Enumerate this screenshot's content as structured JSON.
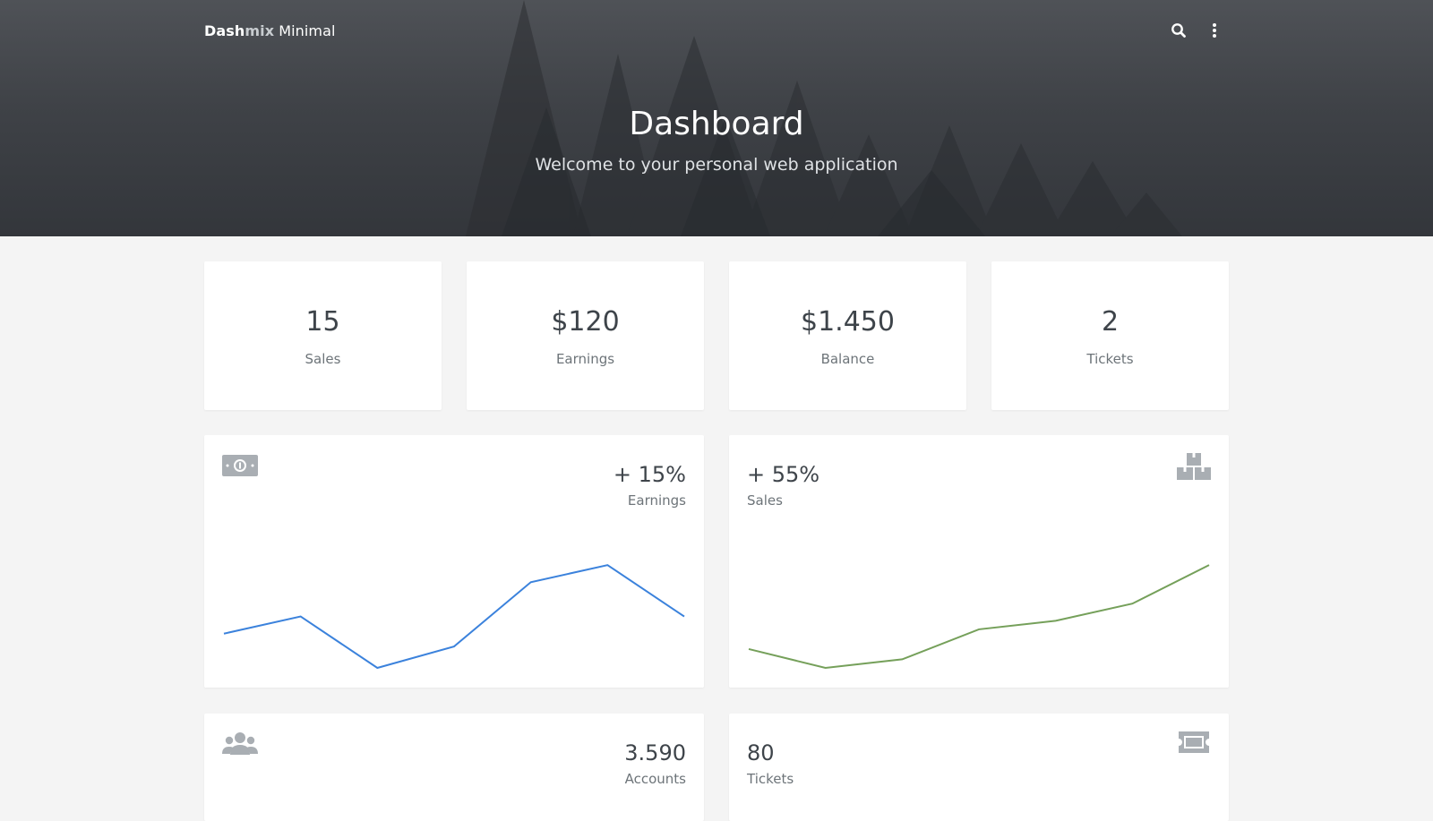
{
  "header": {
    "brand": {
      "part1": "Dash",
      "part2": "mix",
      "part3": "Minimal"
    },
    "title": "Dashboard",
    "subtitle": "Welcome to your personal web application",
    "icons": [
      "search-icon",
      "more-vertical-icon"
    ]
  },
  "stats": [
    {
      "value": "15",
      "label": "Sales"
    },
    {
      "value": "$120",
      "label": "Earnings"
    },
    {
      "value": "$1.450",
      "label": "Balance"
    },
    {
      "value": "2",
      "label": "Tickets"
    }
  ],
  "earnings_card": {
    "value": "+ 15%",
    "label": "Earnings",
    "icon": "money-bill-icon",
    "color": "#3b82dc"
  },
  "sales_card": {
    "value": "+ 55%",
    "label": "Sales",
    "icon": "boxes-icon",
    "color": "#75a05a"
  },
  "accounts_card": {
    "value": "3.590",
    "label": "Accounts",
    "icon": "users-icon"
  },
  "tickets_card": {
    "value": "80",
    "label": "Tickets",
    "icon": "ticket-icon"
  },
  "chart_data": [
    {
      "type": "line",
      "series": [
        {
          "values": [
            4,
            6,
            0,
            2.5,
            10,
            12,
            6
          ]
        }
      ],
      "ylim": [
        0,
        14
      ],
      "color": "#3b82dc"
    },
    {
      "type": "line",
      "series": [
        {
          "values": [
            2.2,
            0,
            1,
            4.5,
            5.5,
            7.5,
            12
          ]
        }
      ],
      "ylim": [
        0,
        14
      ],
      "color": "#75a05a"
    }
  ]
}
